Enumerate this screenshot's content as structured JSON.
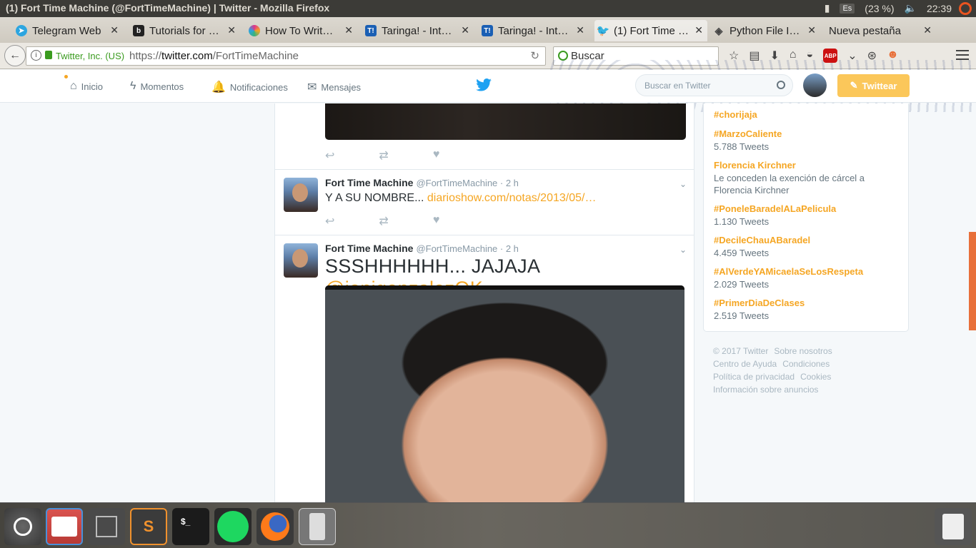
{
  "os": {
    "window_title": "(1) Fort Time Machine (@FortTimeMachine) | Twitter - Mozilla Firefox",
    "keyboard": "Es",
    "battery": "(23 %)",
    "clock": "22:39"
  },
  "tabs": [
    {
      "label": "Telegram Web",
      "icon": "telegram-icon",
      "color": "#2ca5e0"
    },
    {
      "label": "Tutorials for …",
      "icon": "b-icon",
      "color": "#222222"
    },
    {
      "label": "How To Writ…",
      "icon": "flower-icon",
      "color": "#e0348a"
    },
    {
      "label": "Taringa! - Int…",
      "icon": "taringa-icon",
      "color": "#1a5fb4"
    },
    {
      "label": "Taringa! - Int…",
      "icon": "taringa-icon",
      "color": "#1a5fb4"
    },
    {
      "label": "(1) Fort Time …",
      "icon": "twitter-icon",
      "color": "#1da1f2"
    },
    {
      "label": "Python File I…",
      "icon": "python-icon",
      "color": "#444444"
    },
    {
      "label": "Nueva pestaña",
      "icon": "",
      "color": ""
    }
  ],
  "navbar": {
    "org": "Twitter, Inc. (US)",
    "url_prefix": "https://",
    "url_host": "twitter.com",
    "url_path": "/FortTimeMachine",
    "search_placeholder": "Buscar"
  },
  "twitter": {
    "nav": {
      "home": "Inicio",
      "moments": "Momentos",
      "notifications": "Notificaciones",
      "messages": "Mensajes"
    },
    "search_placeholder": "Buscar en Twitter",
    "tweet_button": "Twittear",
    "accent": "#f5a623",
    "tweets": [
      {
        "name": "Fort Time Machine",
        "handle": "@FortTimeMachine · 2 h",
        "text": "Y A SU NOMBRE...",
        "link": "diarioshow.com/notas/2013/05/…"
      },
      {
        "name": "Fort Time Machine",
        "handle": "@FortTimeMachine · 2 h",
        "text": "SSSHHHHHH... JAJAJA",
        "link": "@jonigonzalezOK"
      }
    ],
    "trends": [
      {
        "name": "#chorijaja",
        "meta": ""
      },
      {
        "name": "#MarzoCaliente",
        "meta": "5.788 Tweets"
      },
      {
        "name": "Florencia Kirchner",
        "meta": "Le conceden la exención de cárcel a Florencia Kirchner"
      },
      {
        "name": "#PoneleBaradelALaPelicula",
        "meta": "1.130 Tweets"
      },
      {
        "name": "#DecileChauABaradel",
        "meta": "4.459 Tweets"
      },
      {
        "name": "#AlVerdeYAMicaelaSeLosRespeta",
        "meta": "2.029 Tweets"
      },
      {
        "name": "#PrimerDiaDeClases",
        "meta": "2.519 Tweets"
      }
    ],
    "footer": [
      "© 2017 Twitter",
      "Sobre nosotros",
      "Centro de Ayuda",
      "Condiciones",
      "Política de privacidad",
      "Cookies",
      "Información sobre anuncios"
    ]
  },
  "dock": [
    {
      "name": "ubuntu-dash-icon",
      "label": ""
    },
    {
      "name": "files-icon",
      "label": ""
    },
    {
      "name": "workspaces-icon",
      "label": ""
    },
    {
      "name": "sublime-text-icon",
      "label": "S"
    },
    {
      "name": "terminal-icon",
      "label": "$_"
    },
    {
      "name": "spotify-icon",
      "label": ""
    },
    {
      "name": "firefox-icon",
      "label": ""
    },
    {
      "name": "phone-icon",
      "label": ""
    },
    {
      "name": "trash-icon",
      "label": ""
    }
  ]
}
